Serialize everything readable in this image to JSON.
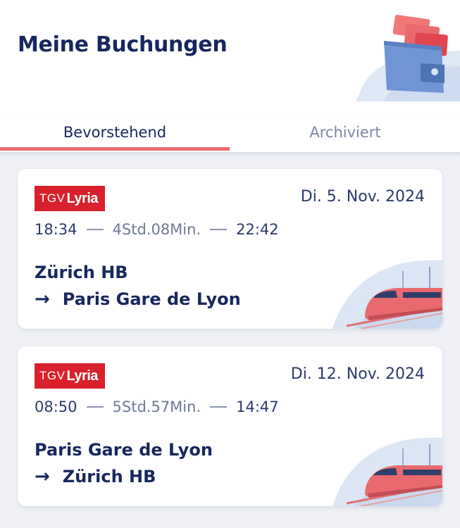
{
  "header": {
    "title": "Meine Buchungen"
  },
  "tabs": [
    {
      "label": "Bevorstehend",
      "active": true
    },
    {
      "label": "Archiviert",
      "active": false
    }
  ],
  "bookings": [
    {
      "operator": {
        "part1": "TGV",
        "part2": "Lyria"
      },
      "date": "Di. 5. Nov. 2024",
      "departure_time": "18:34",
      "duration": "4Std.08Min.",
      "arrival_time": "22:42",
      "from": "Zürich HB",
      "to": "Paris Gare de Lyon"
    },
    {
      "operator": {
        "part1": "TGV",
        "part2": "Lyria"
      },
      "date": "Di. 12. Nov. 2024",
      "departure_time": "08:50",
      "duration": "5Std.57Min.",
      "arrival_time": "14:47",
      "from": "Paris Gare de Lyon",
      "to": "Zürich HB"
    }
  ],
  "colors": {
    "accent": "#e96a6e",
    "brand_red": "#d8212b",
    "navy": "#17275f",
    "background": "#eef0f5"
  }
}
